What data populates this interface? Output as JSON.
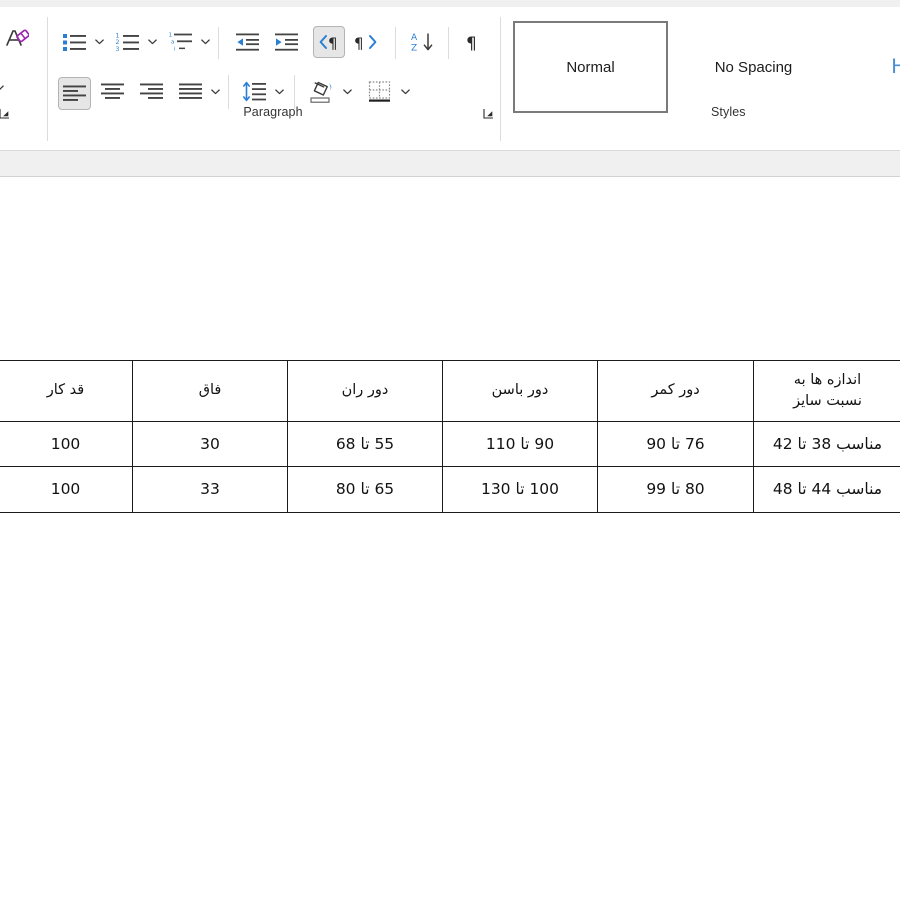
{
  "app": {
    "name": "word-document-editor"
  },
  "ribbon": {
    "groups": [
      {
        "id": "font-remnant",
        "label": "",
        "launcher_name": "font-dialog-launcher"
      },
      {
        "id": "paragraph",
        "label": "Paragraph",
        "launcher_name": "paragraph-dialog-launcher",
        "buttons": [
          {
            "name": "bullets-button",
            "title": "Bullets"
          },
          {
            "name": "bullets-dropdown",
            "title": "Bullets options"
          },
          {
            "name": "numbering-button",
            "title": "Numbering"
          },
          {
            "name": "numbering-dropdown",
            "title": "Numbering options"
          },
          {
            "name": "multilevel-list-button",
            "title": "Multilevel List"
          },
          {
            "name": "multilevel-list-dropdown",
            "title": "Multilevel List options"
          },
          {
            "name": "decrease-indent-button",
            "title": "Decrease Indent"
          },
          {
            "name": "increase-indent-button",
            "title": "Increase Indent"
          },
          {
            "name": "right-to-left-text-direction-button",
            "title": "Right-to-Left Text Direction",
            "active": true
          },
          {
            "name": "left-to-right-text-direction-button",
            "title": "Left-to-Right Text Direction"
          },
          {
            "name": "sort-button",
            "title": "Sort"
          },
          {
            "name": "show-formatting-marks-button",
            "title": "Show/Hide Formatting Marks"
          },
          {
            "name": "align-left-button",
            "title": "Align Left",
            "active": true
          },
          {
            "name": "align-center-button",
            "title": "Center"
          },
          {
            "name": "align-right-button",
            "title": "Align Right"
          },
          {
            "name": "justify-button",
            "title": "Justify"
          },
          {
            "name": "justify-dropdown",
            "title": "Justify options"
          },
          {
            "name": "line-spacing-button",
            "title": "Line and Paragraph Spacing"
          },
          {
            "name": "line-spacing-dropdown",
            "title": "Line spacing options"
          },
          {
            "name": "shading-button",
            "title": "Shading"
          },
          {
            "name": "shading-dropdown",
            "title": "Shading colors"
          },
          {
            "name": "borders-button",
            "title": "Borders"
          },
          {
            "name": "borders-dropdown",
            "title": "Borders options"
          }
        ]
      },
      {
        "id": "styles",
        "label": "Styles",
        "launcher_name": "styles-dialog-launcher"
      }
    ],
    "styles_gallery": [
      {
        "name": "style-normal",
        "label": "Normal",
        "selected": true,
        "kind": "normal"
      },
      {
        "name": "style-no-spacing",
        "label": "No Spacing",
        "selected": false,
        "kind": "normal"
      },
      {
        "name": "style-heading-1",
        "label": "Head",
        "selected": false,
        "kind": "heading"
      }
    ]
  },
  "document": {
    "table": {
      "name": "size-chart-table",
      "direction": "rtl",
      "headers": [
        "اندازه ها به\nنسبت سایز",
        "دور کمر",
        "دور باسن",
        "دور ران",
        "فاق",
        "قد کار"
      ],
      "header_line1": "اندازه ها به",
      "header_line2": "نسبت سایز",
      "rows": [
        {
          "size_range": "مناسب 38 تا 42",
          "waist": "76 تا 90",
          "hip": "90 تا 110",
          "thigh": "55 تا 68",
          "rise": "30",
          "length": "100"
        },
        {
          "size_range": "مناسب 44 تا 48",
          "waist": "80 تا 99",
          "hip": "100 تا 130",
          "thigh": "65 تا 80",
          "rise": "33",
          "length": "100"
        }
      ]
    }
  },
  "colors": {
    "accent_blue": "#2a7fd4",
    "heading_blue": "#4a8fd4",
    "ribbon_bg": "#ffffff",
    "band_gray": "#f0f0f0",
    "table_border": "#1b1b1b",
    "active_button_bg": "#e6e6e6",
    "font_color_red": "#e81123",
    "eraser_purple": "#9c27b0"
  }
}
